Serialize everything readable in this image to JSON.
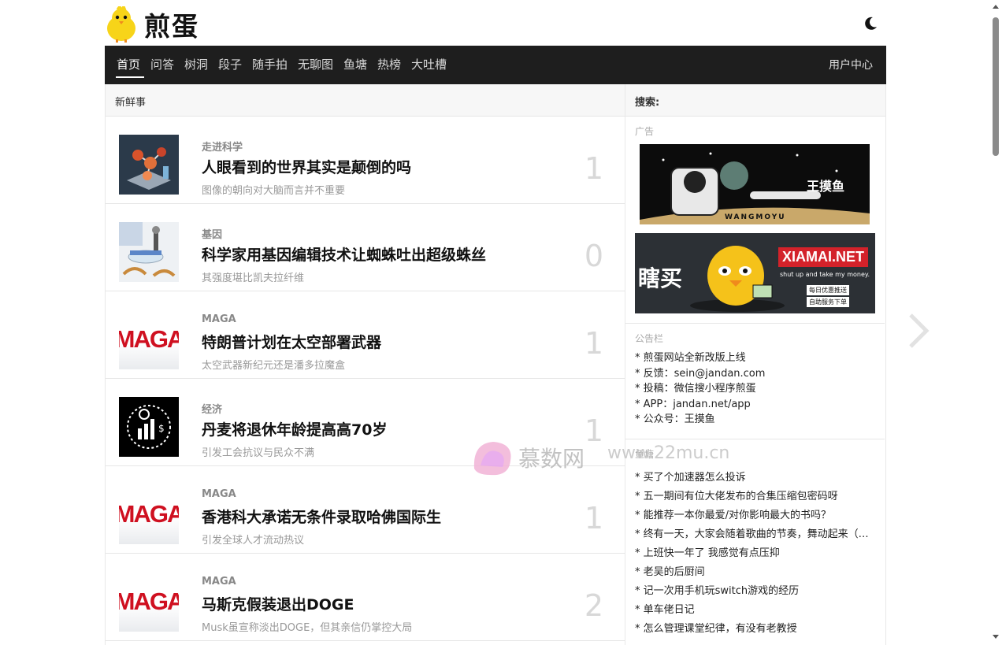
{
  "site": {
    "name": "煎蛋"
  },
  "nav": {
    "items": [
      "首页",
      "问答",
      "树洞",
      "段子",
      "随手拍",
      "无聊图",
      "鱼塘",
      "热榜",
      "大吐槽"
    ],
    "user_center": "用户中心"
  },
  "main": {
    "heading": "新鲜事",
    "posts": [
      {
        "category": "走进科学",
        "title": "人眼看到的世界其实是颠倒的吗",
        "excerpt": "图像的朝向对大脑而言并不重要",
        "comments": "1",
        "thumb": "molecule"
      },
      {
        "category": "基因",
        "title": "科学家用基因编辑技术让蜘蛛吐出超级蛛丝",
        "excerpt": "其强度堪比凯夫拉纤维",
        "comments": "0",
        "thumb": "lab"
      },
      {
        "category": "MAGA",
        "title": "特朗普计划在太空部署武器",
        "excerpt": "太空武器新纪元还是潘多拉魔盒",
        "comments": "1",
        "thumb": "maga"
      },
      {
        "category": "经济",
        "title": "丹麦将退休年龄提高高70岁",
        "excerpt": "引发工会抗议与民众不满",
        "comments": "1",
        "thumb": "economy"
      },
      {
        "category": "MAGA",
        "title": "香港科大承诺无条件录取哈佛国际生",
        "excerpt": "引发全球人才流动热议",
        "comments": "1",
        "thumb": "maga"
      },
      {
        "category": "MAGA",
        "title": "马斯克假装退出DOGE",
        "excerpt": "Musk虽宣称淡出DOGE，但其亲信仍掌控大局",
        "comments": "2",
        "thumb": "maga"
      }
    ],
    "maga_text": "MAGA"
  },
  "sidebar": {
    "search_label": "搜索:",
    "ad_label": "广告",
    "ad1_text": "王摸鱼",
    "ad1_sub": "WANGMOYU",
    "ad2_left": "瞎买",
    "ad2_brand": "XIAMAI.NET",
    "ad2_slogan": "shut up and take my money.",
    "ad2_tag1": "每日优惠推送",
    "ad2_tag2": "自助服务下单",
    "notice_label": "公告栏",
    "notices": [
      "* 煎蛋网站全新改版上线",
      "* 反馈：sein@jandan.com",
      "* 投稿：微信搜小程序煎蛋",
      "* APP：jandan.net/app",
      "* 公众号：王摸鱼"
    ],
    "hot_label": "鱼塘",
    "hot": [
      "* 买了个加速器怎么投诉",
      "* 五一期间有位大佬发布的合集压缩包密码呀",
      "* 能推荐一本你最爱/对你影响最大的书吗？",
      "* 终有一天，大家会随着歌曲的节奏，舞动起来（…",
      "* 上班快一年了 我感觉有点压抑",
      "* 老吴的后厨间",
      "* 记一次用手机玩switch游戏的经历",
      "* 单车佬日记",
      "* 怎么管理课堂纪律，有没有老教授"
    ]
  },
  "watermark": {
    "text": "慕数网",
    "url": "www.22mu.cn"
  }
}
